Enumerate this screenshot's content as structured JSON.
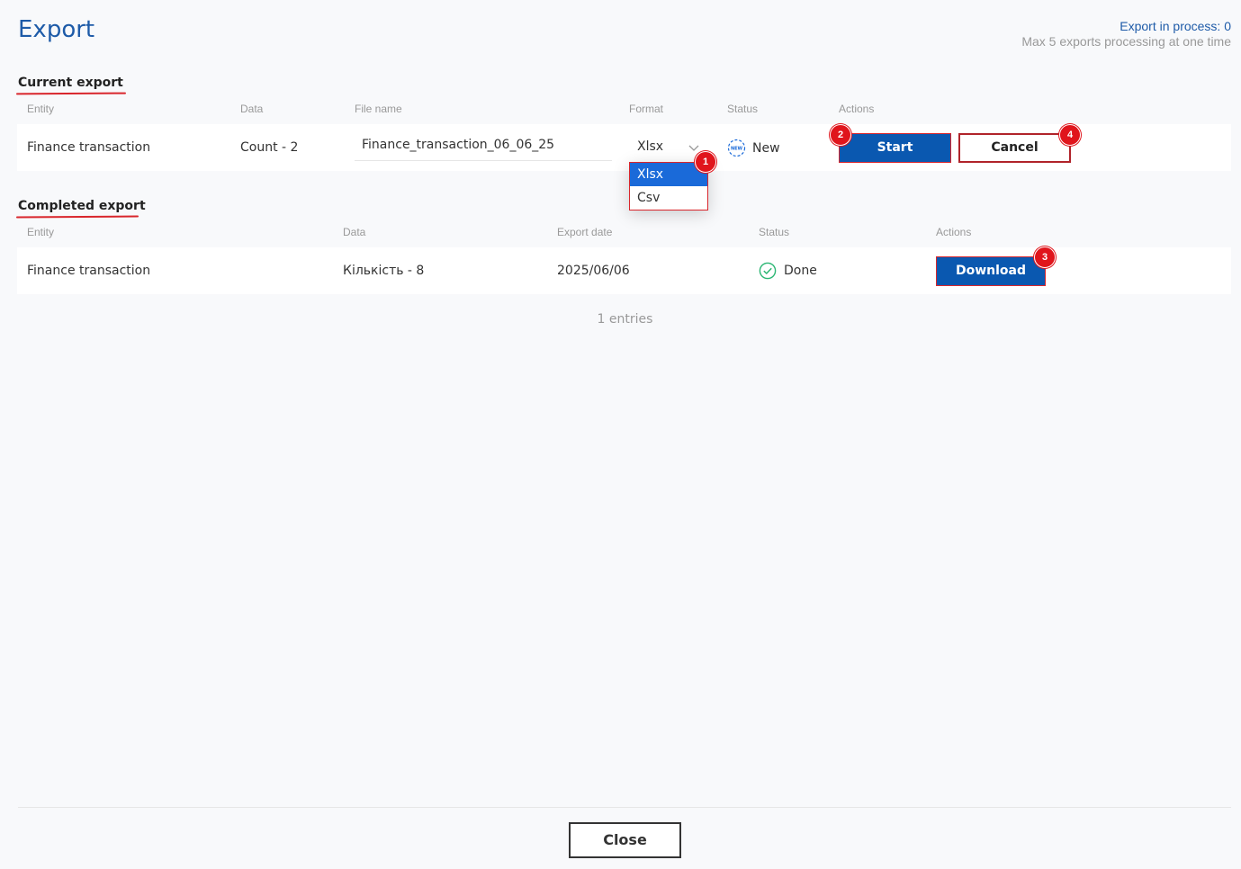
{
  "header": {
    "title": "Export",
    "export_in_process": "Export in process: 0",
    "max_exports": "Max 5 exports processing at one time"
  },
  "current_export": {
    "title": "Current export",
    "columns": [
      "Entity",
      "Data",
      "File name",
      "Format",
      "Status",
      "Actions"
    ],
    "row": {
      "entity": "Finance transaction",
      "data": "Count - 2",
      "file_name": "Finance_transaction_06_06_25",
      "format": "Xlsx",
      "status": "New",
      "status_icon_text": "NEW",
      "start_label": "Start",
      "cancel_label": "Cancel"
    },
    "format_options": [
      "Xlsx",
      "Csv"
    ]
  },
  "completed_export": {
    "title": "Completed export",
    "columns": [
      "Entity",
      "Data",
      "Export date",
      "Status",
      "Actions"
    ],
    "row": {
      "entity": "Finance transaction",
      "data": "Кількість - 8",
      "export_date": "2025/06/06",
      "status": "Done",
      "download_label": "Download"
    },
    "entries": "1 entries"
  },
  "annotations": [
    "1",
    "2",
    "3",
    "4"
  ],
  "footer": {
    "close_label": "Close"
  },
  "colors": {
    "primary": "#0a58b0",
    "accent_red": "#e0151c",
    "done_green": "#2bb673",
    "title_blue": "#1e5ba8"
  }
}
